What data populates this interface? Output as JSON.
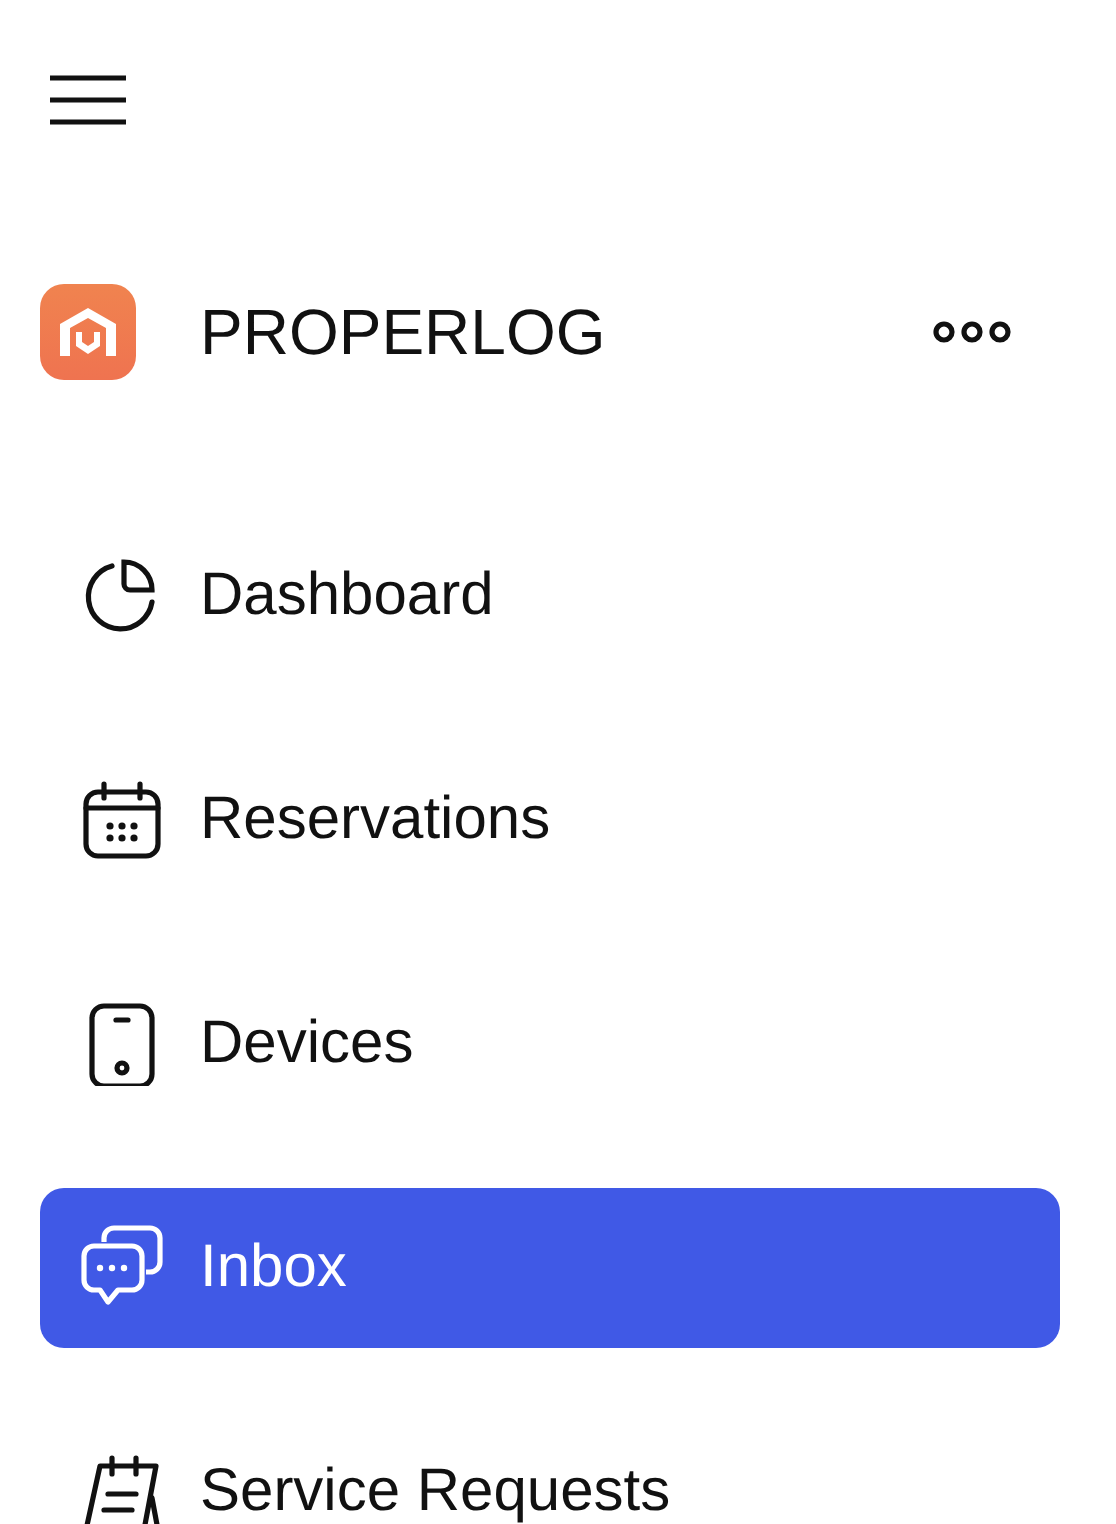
{
  "brand": {
    "name": "PROPERLOG"
  },
  "nav": [
    {
      "label": "Dashboard",
      "selected": false
    },
    {
      "label": "Reservations",
      "selected": false
    },
    {
      "label": "Devices",
      "selected": false
    },
    {
      "label": "Inbox",
      "selected": true
    },
    {
      "label": "Service Requests",
      "selected": false
    }
  ]
}
